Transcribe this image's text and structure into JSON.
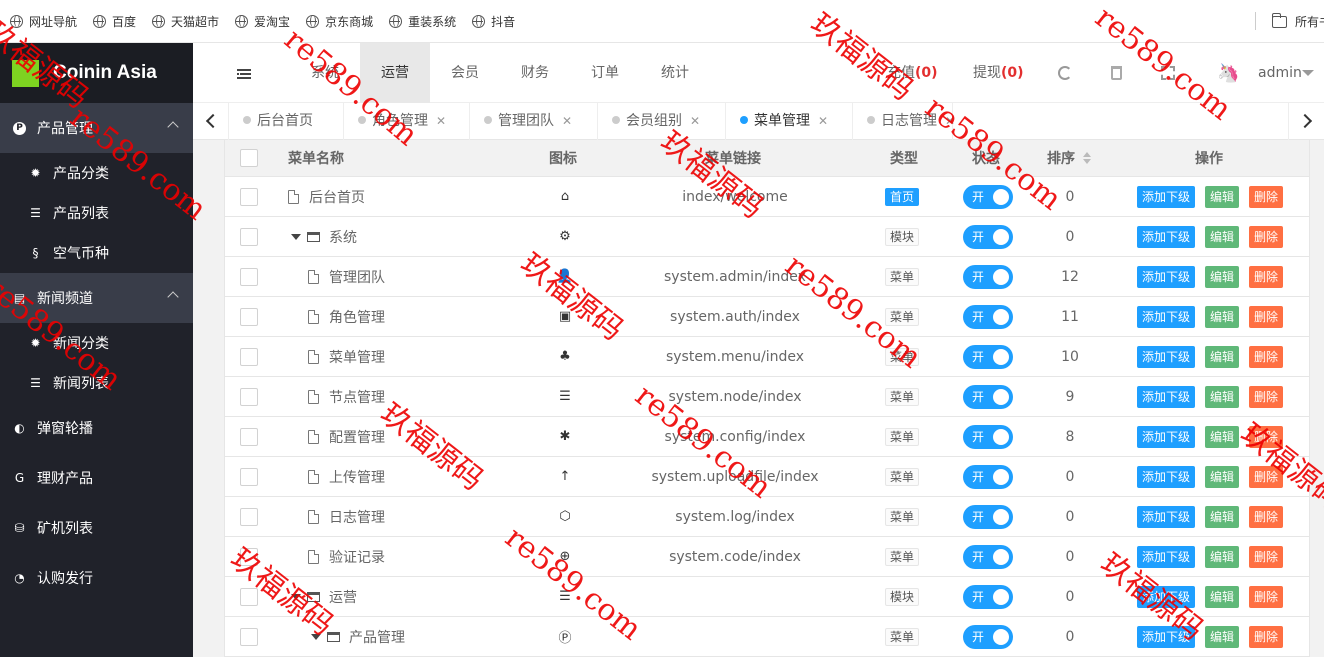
{
  "bookmarks": {
    "items": [
      "网址导航",
      "百度",
      "天猫超市",
      "爱淘宝",
      "京东商城",
      "重装系统",
      "抖音"
    ],
    "folder": "所有书"
  },
  "sidebar": {
    "logo": "Coinin Asia",
    "groups": [
      {
        "label": "产品管理",
        "icon": "product-icon",
        "open": true,
        "items": [
          {
            "label": "产品分类",
            "icon": "gear-icon"
          },
          {
            "label": "产品列表",
            "icon": "list-icon"
          },
          {
            "label": "空气币种",
            "icon": "coin-icon"
          }
        ]
      },
      {
        "label": "新闻频道",
        "icon": "news-icon",
        "open": true,
        "items": [
          {
            "label": "新闻分类",
            "icon": "gear-icon"
          },
          {
            "label": "新闻列表",
            "icon": "list-icon"
          }
        ]
      },
      {
        "label": "弹窗轮播",
        "icon": "carousel-icon"
      },
      {
        "label": "理财产品",
        "icon": "finance-icon"
      },
      {
        "label": "矿机列表",
        "icon": "miner-icon"
      },
      {
        "label": "认购发行",
        "icon": "pie-icon"
      }
    ]
  },
  "topbar": {
    "nav": [
      "系统",
      "运营",
      "会员",
      "财务",
      "订单",
      "统计"
    ],
    "active_nav": "运营",
    "recharge_label": "充值",
    "recharge_count": "(0)",
    "withdraw_label": "提现",
    "withdraw_count": "(0)",
    "user": "admin"
  },
  "tabs": [
    {
      "label": "后台首页",
      "closable": false,
      "active": false
    },
    {
      "label": "角色管理",
      "closable": true,
      "active": false
    },
    {
      "label": "管理团队",
      "closable": true,
      "active": false
    },
    {
      "label": "会员组别",
      "closable": true,
      "active": false
    },
    {
      "label": "菜单管理",
      "closable": true,
      "active": true
    },
    {
      "label": "日志管理",
      "closable": true,
      "active": false
    }
  ],
  "table": {
    "headers": {
      "name": "菜单名称",
      "icon": "图标",
      "link": "菜单链接",
      "type": "类型",
      "status": "状态",
      "sort": "排序",
      "actions": "操作"
    },
    "action_labels": {
      "add": "添加下级",
      "edit": "编辑",
      "delete": "删除"
    },
    "toggle_label": "开",
    "rows": [
      {
        "name": "后台首页",
        "level": 0,
        "kind": "file",
        "icon_glyph": "⌂",
        "icon_name": "home-icon",
        "link": "index/welcome",
        "type": "首页",
        "sort": "0"
      },
      {
        "name": "系统",
        "level": 0,
        "kind": "folder",
        "icon_glyph": "⚙",
        "icon_name": "gear-icon",
        "link": "",
        "type": "模块",
        "sort": "0"
      },
      {
        "name": "管理团队",
        "level": 1,
        "kind": "file",
        "icon_glyph": "👤",
        "icon_name": "user-icon",
        "link": "system.admin/index",
        "type": "菜单",
        "sort": "12"
      },
      {
        "name": "角色管理",
        "level": 1,
        "kind": "file",
        "icon_glyph": "▣",
        "icon_name": "role-icon",
        "link": "system.auth/index",
        "type": "菜单",
        "sort": "11"
      },
      {
        "name": "菜单管理",
        "level": 1,
        "kind": "file",
        "icon_glyph": "♣",
        "icon_name": "tree-icon",
        "link": "system.menu/index",
        "type": "菜单",
        "sort": "10"
      },
      {
        "name": "节点管理",
        "level": 1,
        "kind": "file",
        "icon_glyph": "☰",
        "icon_name": "list-icon",
        "link": "system.node/index",
        "type": "菜单",
        "sort": "9"
      },
      {
        "name": "配置管理",
        "level": 1,
        "kind": "file",
        "icon_glyph": "✱",
        "icon_name": "asterisk-icon",
        "link": "system.config/index",
        "type": "菜单",
        "sort": "8"
      },
      {
        "name": "上传管理",
        "level": 1,
        "kind": "file",
        "icon_glyph": "↑",
        "icon_name": "upload-icon",
        "link": "system.uploadfile/index",
        "type": "菜单",
        "sort": "0"
      },
      {
        "name": "日志管理",
        "level": 1,
        "kind": "file",
        "icon_glyph": "⬡",
        "icon_name": "log-icon",
        "link": "system.log/index",
        "type": "菜单",
        "sort": "0"
      },
      {
        "name": "验证记录",
        "level": 1,
        "kind": "file",
        "icon_glyph": "⊕",
        "icon_name": "verify-icon",
        "link": "system.code/index",
        "type": "菜单",
        "sort": "0"
      },
      {
        "name": "运营",
        "level": 0,
        "kind": "folder",
        "icon_glyph": "☰",
        "icon_name": "list-icon",
        "link": "",
        "type": "模块",
        "sort": "0"
      },
      {
        "name": "产品管理",
        "level": 1,
        "kind": "folder",
        "icon_glyph": "Ⓟ",
        "icon_name": "product-icon",
        "link": "",
        "type": "菜单",
        "sort": "0"
      }
    ]
  },
  "watermark": {
    "brand": "玖福源码",
    "domain": "re589.com"
  },
  "colors": {
    "sidebar_bg": "#20222a",
    "sidebar_active_group": "#393d49",
    "primary": "#1e9fff",
    "success": "#5fb878",
    "danger": "#ff5722",
    "watermark": "#e00000"
  }
}
